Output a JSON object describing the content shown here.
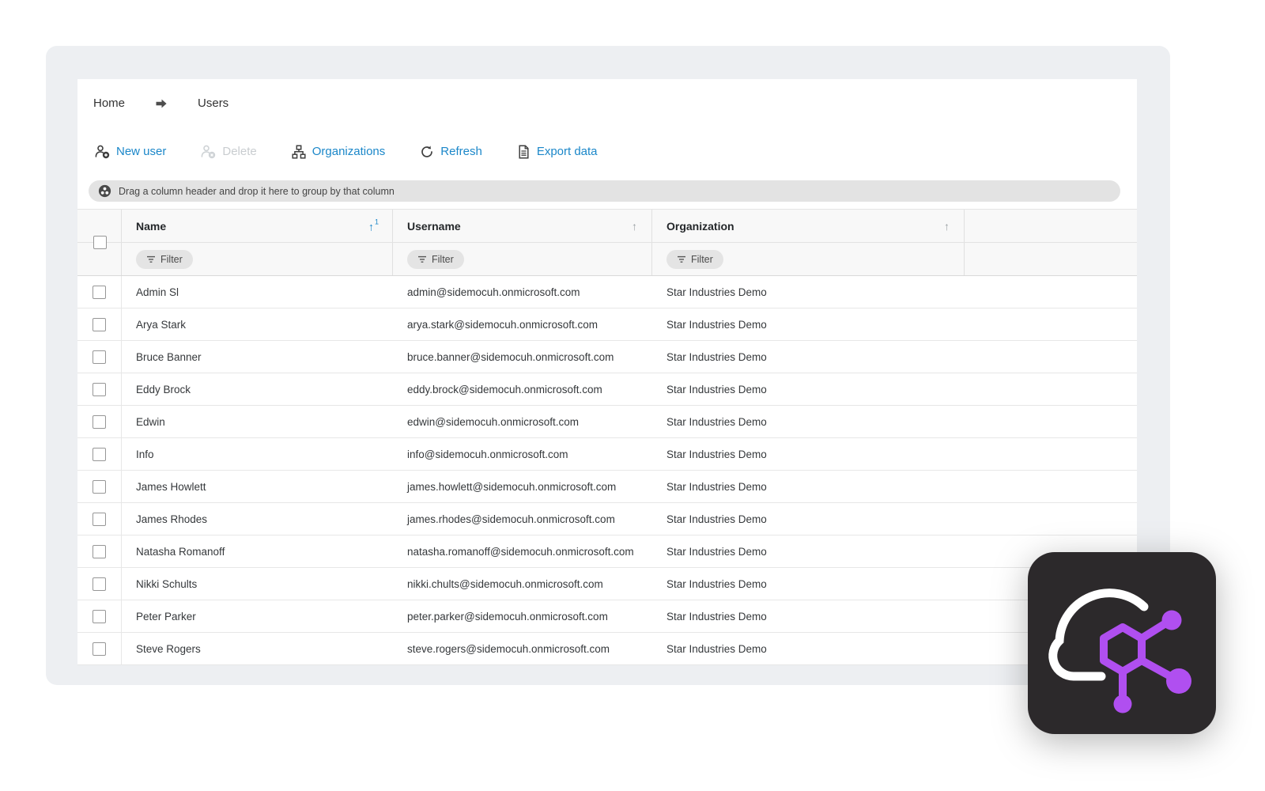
{
  "colors": {
    "accent_blue": "#1b87c9",
    "disabled_gray": "#c9cdd0",
    "panel_bg": "#edeff2",
    "logo_bg": "#2c292b",
    "logo_molecule": "#b04ff0",
    "logo_cloud": "#ffffff"
  },
  "breadcrumb": {
    "items": [
      "Home",
      "Users"
    ],
    "separator_icon": "arrow-right-icon"
  },
  "toolbar": {
    "buttons": [
      {
        "label": "New user",
        "icon": "user-add-icon",
        "enabled": true
      },
      {
        "label": "Delete",
        "icon": "user-remove-icon",
        "enabled": false
      },
      {
        "label": "Organizations",
        "icon": "org-chart-icon",
        "enabled": true
      },
      {
        "label": "Refresh",
        "icon": "refresh-icon",
        "enabled": true
      },
      {
        "label": "Export data",
        "icon": "export-file-icon",
        "enabled": true
      }
    ]
  },
  "group_bar": {
    "icon": "group-columns-icon",
    "text": "Drag a column header and drop it here to group by that column"
  },
  "table": {
    "select_all_checked": false,
    "filter_label": "Filter",
    "sort_asc_glyph": "↑",
    "columns": [
      {
        "label": "Name",
        "sort": "asc",
        "sort_order": "1"
      },
      {
        "label": "Username",
        "sort": "none",
        "sort_order": ""
      },
      {
        "label": "Organization",
        "sort": "none",
        "sort_order": ""
      }
    ],
    "rows": [
      {
        "name": "Admin Sl",
        "username": "admin@sidemocuh.onmicrosoft.com",
        "organization": "Star Industries Demo",
        "checked": false
      },
      {
        "name": "Arya Stark",
        "username": "arya.stark@sidemocuh.onmicrosoft.com",
        "organization": "Star Industries Demo",
        "checked": false
      },
      {
        "name": "Bruce Banner",
        "username": "bruce.banner@sidemocuh.onmicrosoft.com",
        "organization": "Star Industries Demo",
        "checked": false
      },
      {
        "name": "Eddy Brock",
        "username": "eddy.brock@sidemocuh.onmicrosoft.com",
        "organization": "Star Industries Demo",
        "checked": false
      },
      {
        "name": "Edwin",
        "username": "edwin@sidemocuh.onmicrosoft.com",
        "organization": "Star Industries Demo",
        "checked": false
      },
      {
        "name": "Info",
        "username": "info@sidemocuh.onmicrosoft.com",
        "organization": "Star Industries Demo",
        "checked": false
      },
      {
        "name": "James Howlett",
        "username": "james.howlett@sidemocuh.onmicrosoft.com",
        "organization": "Star Industries Demo",
        "checked": false
      },
      {
        "name": "James Rhodes",
        "username": "james.rhodes@sidemocuh.onmicrosoft.com",
        "organization": "Star Industries Demo",
        "checked": false
      },
      {
        "name": "Natasha Romanoff",
        "username": "natasha.romanoff@sidemocuh.onmicrosoft.com",
        "organization": "Star Industries Demo",
        "checked": false
      },
      {
        "name": "Nikki Schults",
        "username": "nikki.chults@sidemocuh.onmicrosoft.com",
        "organization": "Star Industries Demo",
        "checked": false
      },
      {
        "name": "Peter Parker",
        "username": "peter.parker@sidemocuh.onmicrosoft.com",
        "organization": "Star Industries Demo",
        "checked": false
      },
      {
        "name": "Steve Rogers",
        "username": "steve.rogers@sidemocuh.onmicrosoft.com",
        "organization": "Star Industries Demo",
        "checked": false
      }
    ]
  },
  "logo": {
    "name": "cloud-molecule-app-logo"
  }
}
